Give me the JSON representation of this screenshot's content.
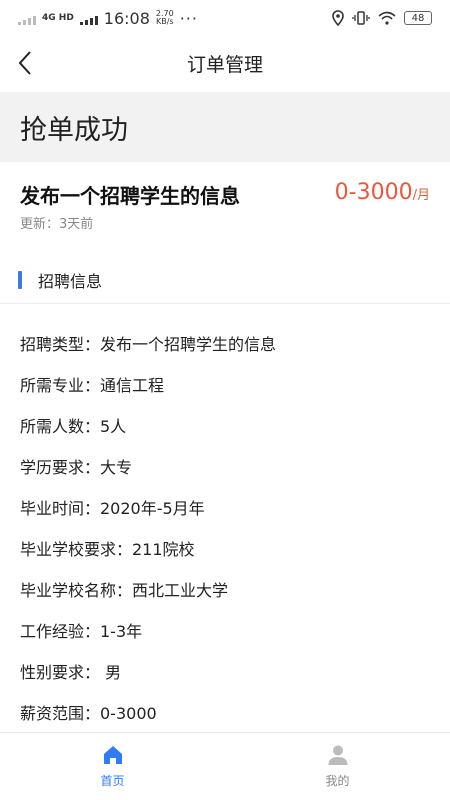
{
  "status_bar": {
    "network": "4G HD",
    "time": "16:08",
    "speed_value": "2.70",
    "speed_unit": "KB/s",
    "more": "···",
    "battery": "48"
  },
  "nav": {
    "title": "订单管理"
  },
  "banner": {
    "text": "抢单成功"
  },
  "order": {
    "title": "发布一个招聘学生的信息",
    "salary": "0-3000",
    "salary_unit": "/月",
    "updated": "更新：3天前"
  },
  "section": {
    "title": "招聘信息"
  },
  "details": [
    "招聘类型：发布一个招聘学生的信息",
    "所需专业：通信工程",
    "所需人数：5人",
    "学历要求：大专",
    "毕业时间：2020年-5月年",
    "毕业学校要求：211院校",
    "毕业学校名称：西北工业大学",
    "工作经验：1-3年",
    "性别要求： 男",
    "薪资范围：0-3000"
  ],
  "tabs": [
    {
      "label": "首页",
      "icon": "home-icon"
    },
    {
      "label": "我的",
      "icon": "user-icon"
    }
  ],
  "colors": {
    "accent": "#3a79e6",
    "salary": "#e8583c",
    "tab_active": "#2f7cf6",
    "tab_inactive": "#bbbbbb"
  }
}
